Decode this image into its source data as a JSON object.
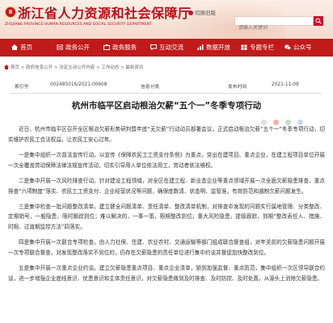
{
  "header": {
    "site_title": "浙江省人力资源和社会保障厅",
    "site_subtitle": "ZHEJIANG PROVINCE HUMAN RESOURCES AND SOCIAL SECURITY DEPARTMENT",
    "old_version_label": "切换旧版",
    "search_placeholder": "请输入关键词"
  },
  "nav": {
    "items": [
      {
        "label": "首页"
      },
      {
        "label": "政务公开"
      },
      {
        "label": "政务服务"
      },
      {
        "label": "互动交流"
      },
      {
        "label": "数据开放"
      },
      {
        "label": "专题专栏"
      },
      {
        "label": "公众号"
      }
    ]
  },
  "breadcrumb": {
    "path": "首页 > 政府信息公开 > 法定主动公开内容 > 工作动态 > 最新资讯"
  },
  "meta": {
    "index_label": "索引号",
    "index_value": "002485016/2021-00608",
    "category_label": "信息分类",
    "category_value": "",
    "date_label": "发布时间",
    "date_value": "2021-11-09"
  },
  "article": {
    "title": "杭州市临平区启动根治欠薪“五个一”冬季专项行动",
    "paragraphs": [
      "近日，杭州市临平区召开全区根治欠薪形势研判暨年底“无欠薪”行动动员部署会议，正式启动根治欠薪“五个一”冬季专项行动，切实维护农民工合法权益，让农民工安心过年。",
      "一是集中组织一次普法宣传行动。以宣传《保障农民工工资支付条例》为重点，突出在建项目、重点企业，在建工程项目单位开展一次全覆盖劳动保障法律法规宣传活动，切实引导用人单位依法用工，劳动者依法维权。",
      "二是集中开展一次风险排查行动。针对建设工程领域，对全区在建工程、新业态企业等重点领域开展一次全面欠薪隐患排查，重点排查“六项制度”落实、农民工工资支付、企业经营状况等问题，确保底数清、状态明、监管准，有效防范和遏制欠薪问题发生。",
      "三是集中检查一批问题整改清单。建立健全问题清单、责任清单、整改清单机制，对排查中发现的问题实行属地管理、分类整改、定期销号，一般隐患，限时跟踪到位；难以解决的，一事一策，限期整改到位；重大风险隐患，提级跟踪，到期“整改表任人、措施、时限、过渡期监控方法”四落实。",
      "四是集中开展一次联合专项检查。由人力社保、住建、农业农村、交通运输等部门组成联合督查组，对年关前的欠薪隐患问题开展一次专项联合督查，对发现整改落实不到位的，仍存在欠薪隐患的责任单位进行集中约谈并督促加快整改到位。",
      "五是集中开展一次重点企业约谈。建立欠薪隐患重点项目、重点企业清单，锁到加强监督、重点防范，集中组织一次区领导联合约谈，进一步增强企业底线意识、忧患意识和主体责任意识，对欠薪隐患做到及时排查、及时防控、及时处置，从源头上消除欠薪隐患。"
    ]
  },
  "colors": {
    "brand_red": "#c11a1a",
    "title_red": "#b80f19"
  }
}
